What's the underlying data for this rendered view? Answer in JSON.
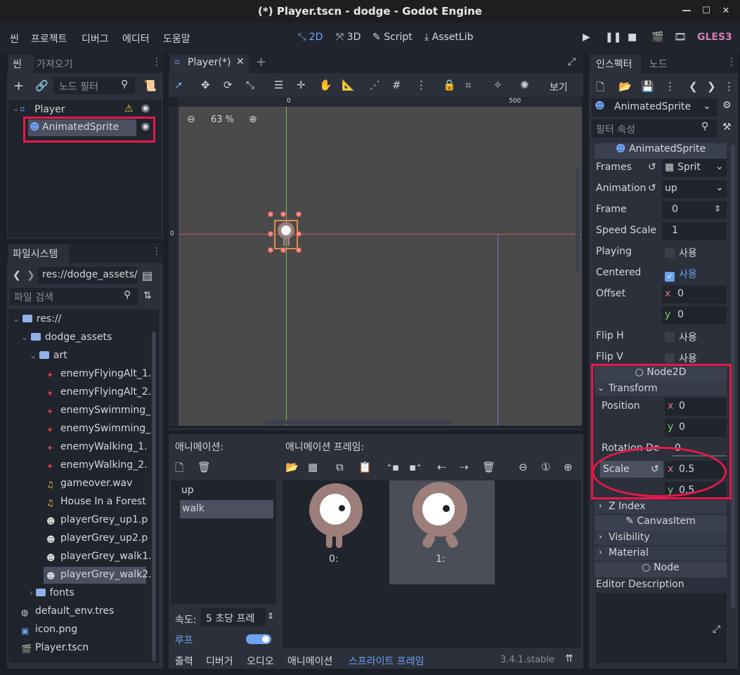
{
  "window": {
    "title": "(*) Player.tscn - dodge - Godot Engine",
    "minimize": "—",
    "maximize": "☐",
    "close": "✕"
  },
  "menu": {
    "items": [
      "씬",
      "프로젝트",
      "디버그",
      "에디터",
      "도움말"
    ],
    "workspaces": [
      "2D",
      "3D",
      "Script",
      "AssetLib"
    ],
    "renderer": "GLES3"
  },
  "scene_panel": {
    "tabs": [
      "씬",
      "가져오기"
    ],
    "filter_placeholder": "노드 필터",
    "nodes": [
      {
        "name": "Player"
      },
      {
        "name": "AnimatedSprite"
      }
    ]
  },
  "filesystem": {
    "title": "파일시스템",
    "path": "res://dodge_assets/",
    "search_placeholder": "파일 검색",
    "items": [
      {
        "label": "res://",
        "kind": "folder"
      },
      {
        "label": "dodge_assets",
        "kind": "folder"
      },
      {
        "label": "art",
        "kind": "folder"
      },
      {
        "label": "enemyFlyingAlt_1.",
        "kind": "enemy"
      },
      {
        "label": "enemyFlyingAlt_2.",
        "kind": "enemy"
      },
      {
        "label": "enemySwimming_",
        "kind": "enemy"
      },
      {
        "label": "enemySwimming_",
        "kind": "enemy"
      },
      {
        "label": "enemyWalking_1.",
        "kind": "enemy"
      },
      {
        "label": "enemyWalking_2.",
        "kind": "enemy"
      },
      {
        "label": "gameover.wav",
        "kind": "audio"
      },
      {
        "label": "House In a Forest",
        "kind": "audio"
      },
      {
        "label": "playerGrey_up1.p",
        "kind": "player"
      },
      {
        "label": "playerGrey_up2.p",
        "kind": "player"
      },
      {
        "label": "playerGrey_walk1.",
        "kind": "player"
      },
      {
        "label": "playerGrey_walk2.",
        "kind": "player"
      },
      {
        "label": "fonts",
        "kind": "folder"
      },
      {
        "label": "default_env.tres",
        "kind": "env"
      },
      {
        "label": "icon.png",
        "kind": "image"
      },
      {
        "label": "Player.tscn",
        "kind": "scene"
      }
    ]
  },
  "viewport": {
    "tab": "Player(*)",
    "zoom": "63 %",
    "view_label": "보기",
    "ruler_0": "0",
    "ruler_500": "500",
    "ruler_left_0": "0"
  },
  "anim_panel": {
    "animations_label": "애니메이션:",
    "frames_label": "애니메이션 프레임:",
    "animations": [
      "up",
      "walk"
    ],
    "frames": [
      "0:",
      "1:"
    ],
    "speed_label": "속도:",
    "speed_value": "5 초당 프레",
    "loop_label": "루프",
    "bottom_tabs": [
      "출력",
      "디버거",
      "오디오",
      "애니메이션",
      "스프라이트 프레임"
    ],
    "version": "3.4.1.stable"
  },
  "inspector": {
    "tabs": [
      "인스펙터",
      "노드"
    ],
    "node_type": "AnimatedSprite",
    "filter_placeholder": "필터 속성",
    "section_animated": "AnimatedSprite",
    "props": {
      "frames_label": "Frames",
      "frames_value": "Sprit",
      "animation_label": "Animation",
      "animation_value": "up",
      "frame_label": "Frame",
      "frame_value": "0",
      "speed_label": "Speed Scale",
      "speed_value": "1",
      "playing_label": "Playing",
      "playing_value": "사용",
      "centered_label": "Centered",
      "centered_value": "사용",
      "offset_label": "Offset",
      "offset_x": "0",
      "offset_y": "0",
      "fliph_label": "Flip H",
      "fliph_value": "사용",
      "flipv_label": "Flip V",
      "flipv_value": "사용"
    },
    "section_node2d": "Node2D",
    "transform_label": "Transform",
    "position_label": "Position",
    "position_x": "0",
    "position_y": "0",
    "rotation_label": "Rotation De",
    "rotation_value": "0",
    "scale_label": "Scale",
    "scale_x": "0.5",
    "scale_y": "0.5",
    "zindex_label": "Z Index",
    "section_canvas": "CanvasItem",
    "visibility_label": "Visibility",
    "material_label": "Material",
    "section_node": "Node",
    "editor_desc_label": "Editor Description"
  },
  "axis_letters": {
    "x": "x",
    "y": "y"
  },
  "colors": {
    "highlight": "#e8194a",
    "accent": "#6ea3f2",
    "sprite": "#9c7f7a"
  }
}
